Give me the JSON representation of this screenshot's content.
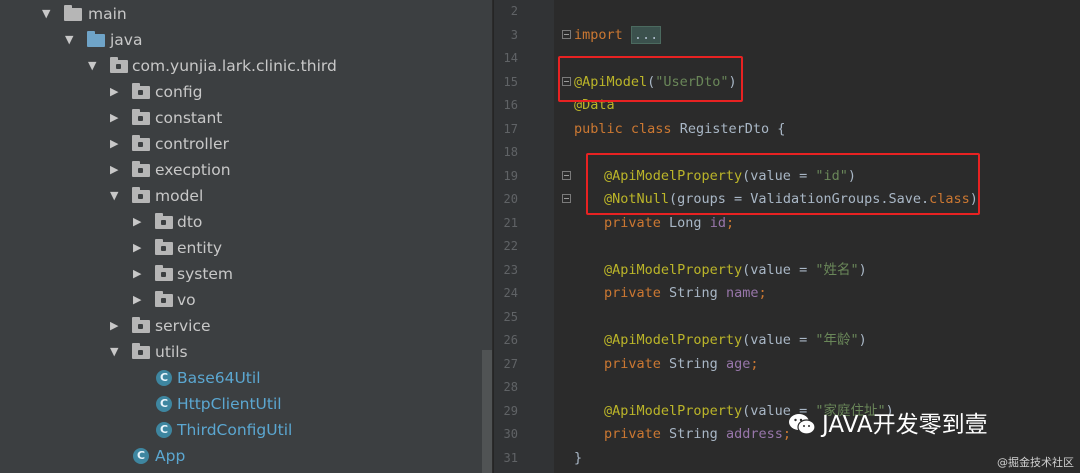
{
  "project_tree": {
    "items": [
      {
        "label": "main",
        "expanded": true,
        "icon": "folder-icon"
      },
      {
        "label": "java",
        "expanded": true,
        "icon": "source-folder-icon"
      },
      {
        "label": "com.yunjia.lark.clinic.third",
        "expanded": true,
        "icon": "package-icon"
      },
      {
        "label": "config",
        "expanded": false,
        "icon": "package-icon"
      },
      {
        "label": "constant",
        "expanded": false,
        "icon": "package-icon"
      },
      {
        "label": "controller",
        "expanded": false,
        "icon": "package-icon"
      },
      {
        "label": "execption",
        "expanded": false,
        "icon": "package-icon"
      },
      {
        "label": "model",
        "expanded": true,
        "icon": "package-icon"
      },
      {
        "label": "dto",
        "expanded": false,
        "icon": "package-icon"
      },
      {
        "label": "entity",
        "expanded": false,
        "icon": "package-icon"
      },
      {
        "label": "system",
        "expanded": false,
        "icon": "package-icon"
      },
      {
        "label": "vo",
        "expanded": false,
        "icon": "package-icon"
      },
      {
        "label": "service",
        "expanded": false,
        "icon": "package-icon"
      },
      {
        "label": "utils",
        "expanded": true,
        "icon": "package-icon"
      },
      {
        "label": "Base64Util",
        "icon": "class-icon"
      },
      {
        "label": "HttpClientUtil",
        "icon": "class-icon"
      },
      {
        "label": "ThirdConfigUtil",
        "icon": "class-icon"
      },
      {
        "label": "App",
        "icon": "class-icon"
      }
    ]
  },
  "editor": {
    "line_numbers": [
      "2",
      "3",
      "14",
      "15",
      "16",
      "17",
      "18",
      "19",
      "20",
      "21",
      "22",
      "23",
      "24",
      "25",
      "26",
      "27",
      "28",
      "29",
      "30",
      "31"
    ],
    "lines": {
      "import_kw": "import",
      "import_fold": "...",
      "api_model": "@ApiModel",
      "api_model_open": "(",
      "api_model_str": "\"UserDto\"",
      "api_model_close": ")",
      "data_ann": "@Data",
      "class_public": "public",
      "class_kw": "class",
      "class_name": " RegisterDto {",
      "prop_id_ann": "@ApiModelProperty",
      "prop_id_open": "(value = ",
      "prop_id_str": "\"id\"",
      "prop_id_close": ")",
      "notnull_ann": "@NotNull",
      "notnull_args": "(groups = ValidationGroups.Save.",
      "notnull_class": "class",
      "notnull_close": ")",
      "id_private": "private",
      "id_type": " Long ",
      "id_field": "id",
      "id_semi": ";",
      "prop_name_ann": "@ApiModelProperty",
      "prop_name_open": "(value = ",
      "prop_name_str": "\"姓名\"",
      "prop_name_close": ")",
      "name_private": "private",
      "name_type": " String ",
      "name_field": "name",
      "name_semi": ";",
      "prop_age_ann": "@ApiModelProperty",
      "prop_age_open": "(value = ",
      "prop_age_str": "\"年龄\"",
      "prop_age_close": ")",
      "age_private": "private",
      "age_type": " String ",
      "age_field": "age",
      "age_semi": ";",
      "prop_addr_ann": "@ApiModelProperty",
      "prop_addr_open": "(value = ",
      "prop_addr_str": "\"家庭住址\"",
      "prop_addr_close": ")",
      "addr_private": "private",
      "addr_type": " String ",
      "addr_field": "address",
      "addr_semi": ";",
      "close_brace": "}"
    }
  },
  "watermark": {
    "text": "JAVA开发零到壹",
    "source": "@掘金技术社区"
  },
  "colors": {
    "highlight_box": "#e82222",
    "keyword": "#cc7832",
    "annotation": "#bbb529",
    "string": "#6a8759",
    "field": "#9876aa"
  }
}
